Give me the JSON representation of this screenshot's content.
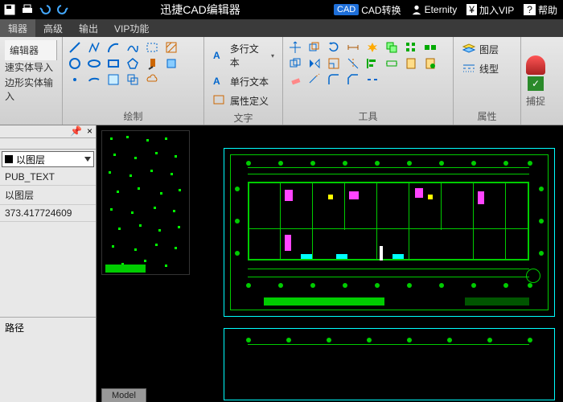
{
  "titlebar": {
    "title": "迅捷CAD编辑器",
    "cad_badge": "CAD",
    "convert": "CAD转换",
    "user": "Eternity",
    "vip_symbol": "¥",
    "vip": "加入VIP",
    "help_symbol": "?",
    "help": "帮助"
  },
  "menu": {
    "m1": "辑器",
    "m2": "高级",
    "m3": "输出",
    "m4": "VIP功能"
  },
  "ribbon": {
    "side_label": "编辑器",
    "side_a": "速实体导入",
    "side_b": "边形实体输入",
    "g_draw": "绘制",
    "g_text": "文字",
    "text_multi": "多行文本",
    "text_single": "单行文本",
    "text_attr": "属性定义",
    "g_tools": "工具",
    "g_prop": "属性",
    "prop_layer": "图层",
    "prop_linetype": "线型",
    "snap": "捕捉"
  },
  "panel": {
    "combo": "以图层",
    "r1": "PUB_TEXT",
    "r2": "以图层",
    "r3": "373.417724609",
    "path": "路径"
  },
  "canvas": {
    "model_tab": "Model"
  }
}
